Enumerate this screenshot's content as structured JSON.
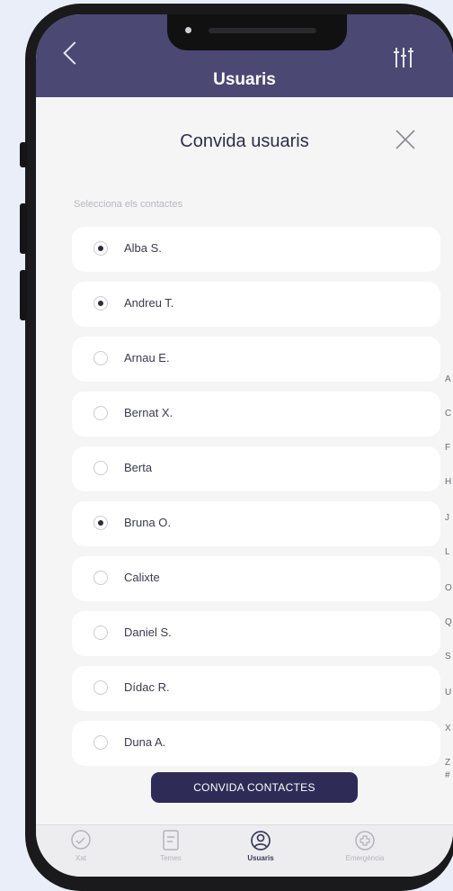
{
  "header": {
    "title": "Usuaris",
    "back_icon": "chevron-left-icon",
    "filter_icon": "sliders-icon",
    "color": "#4b4873"
  },
  "modal": {
    "title": "Convida usuaris",
    "close_icon": "close-icon",
    "select_label": "Selecciona els contactes",
    "contacts": [
      {
        "name": "Alba S.",
        "selected": true
      },
      {
        "name": "Andreu T.",
        "selected": true
      },
      {
        "name": "Arnau E.",
        "selected": false
      },
      {
        "name": "Bernat X.",
        "selected": false
      },
      {
        "name": "Berta",
        "selected": false
      },
      {
        "name": "Bruna O.",
        "selected": true
      },
      {
        "name": "Calixte",
        "selected": false
      },
      {
        "name": "Daniel S.",
        "selected": false
      },
      {
        "name": "Dídac R.",
        "selected": false
      },
      {
        "name": "Duna A.",
        "selected": false
      }
    ],
    "index_letters": [
      "A",
      "C",
      "F",
      "H",
      "J",
      "L",
      "O",
      "Q",
      "S",
      "U",
      "X",
      "Z",
      "#"
    ],
    "invite_button": "CONVIDA CONTACTES",
    "button_color": "#2e2c57"
  },
  "nav": {
    "items": [
      {
        "label": "Xat",
        "icon": "chat-bubble-icon",
        "active": false
      },
      {
        "label": "Temes",
        "icon": "document-icon",
        "active": false
      },
      {
        "label": "Usuaris",
        "icon": "user-icon",
        "active": true
      },
      {
        "label": "Emergència",
        "icon": "emergency-icon",
        "active": false
      }
    ]
  }
}
